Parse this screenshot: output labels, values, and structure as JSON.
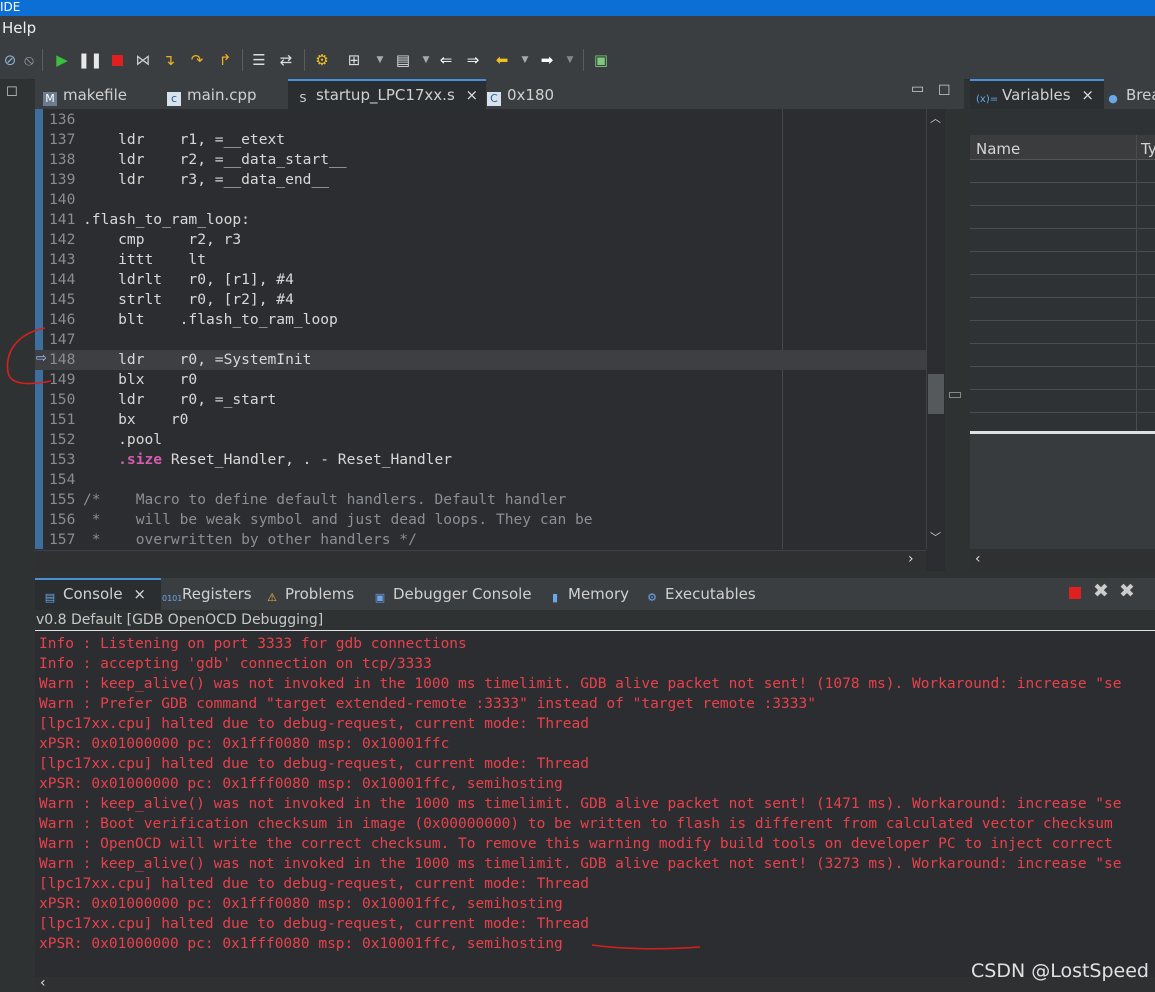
{
  "window": {
    "title_fragment": "IDE"
  },
  "menu": {
    "help": "Help"
  },
  "toolbar": {
    "icons": [
      "skip-breakpoints-icon",
      "resume-icon",
      "suspend-icon",
      "terminate-icon",
      "disconnect-icon",
      "step-into-icon",
      "step-over-icon",
      "step-return-icon",
      "instruction-stepping-icon",
      "restart-icon",
      "build-icon",
      "debug-config-icon",
      "external-tool-icon",
      "back-icon",
      "forward-icon",
      "prev-edit-icon",
      "next-edit-icon",
      "new-window-icon"
    ]
  },
  "editor": {
    "tabs": [
      {
        "label": "makefile",
        "icon": "makefile-icon"
      },
      {
        "label": "main.cpp",
        "icon": "cpp-file-icon"
      },
      {
        "label": "startup_LPC17xx.s",
        "icon": "asm-file-icon",
        "active": true,
        "close": "×"
      },
      {
        "label": "0x180",
        "icon": "disassembly-icon"
      }
    ],
    "lines": [
      {
        "num": "136",
        "text": ""
      },
      {
        "num": "137",
        "text": "    ldr    r1, =__etext"
      },
      {
        "num": "138",
        "text": "    ldr    r2, =__data_start__"
      },
      {
        "num": "139",
        "text": "    ldr    r3, =__data_end__"
      },
      {
        "num": "140",
        "text": ""
      },
      {
        "num": "141",
        "text": ".flash_to_ram_loop:"
      },
      {
        "num": "142",
        "text": "    cmp     r2, r3"
      },
      {
        "num": "143",
        "text": "    ittt    lt"
      },
      {
        "num": "144",
        "text": "    ldrlt   r0, [r1], #4"
      },
      {
        "num": "145",
        "text": "    strlt   r0, [r2], #4"
      },
      {
        "num": "146",
        "text": "    blt    .flash_to_ram_loop"
      },
      {
        "num": "147",
        "text": ""
      },
      {
        "num": "148",
        "text": "    ldr    r0, =SystemInit"
      },
      {
        "num": "149",
        "text": "    blx    r0"
      },
      {
        "num": "150",
        "text": "    ldr    r0, =_start"
      },
      {
        "num": "151",
        "text": "    bx    r0"
      },
      {
        "num": "152",
        "text": "    .pool"
      },
      {
        "num": "153",
        "kw": "    .size",
        "text": " Reset_Handler, . - Reset_Handler"
      },
      {
        "num": "154",
        "text": ""
      },
      {
        "num": "155",
        "text": "/*    Macro to define default handlers. Default handler"
      },
      {
        "num": "156",
        "text": " *    will be weak symbol and just dead loops. They can be"
      },
      {
        "num": "157",
        "text": " *    overwritten by other handlers */"
      }
    ],
    "current_line": "148"
  },
  "variables": {
    "tabs": [
      {
        "label": "Variables",
        "icon": "variables-icon",
        "close": "×"
      },
      {
        "label": "Brea",
        "icon": "breakpoints-icon"
      }
    ],
    "columns": [
      "Name",
      "Ty"
    ]
  },
  "console": {
    "tabs": [
      {
        "label": "Console",
        "icon": "console-icon",
        "close": "×"
      },
      {
        "label": "Registers",
        "icon": "registers-icon"
      },
      {
        "label": "Problems",
        "icon": "problems-icon"
      },
      {
        "label": "Debugger Console",
        "icon": "debugger-console-icon"
      },
      {
        "label": "Memory",
        "icon": "memory-icon"
      },
      {
        "label": "Executables",
        "icon": "executables-icon"
      }
    ],
    "session": "v0.8 Default [GDB OpenOCD Debugging]",
    "lines": [
      "Info : Listening on port 3333 for gdb connections",
      "Info : accepting 'gdb' connection on tcp/3333",
      "Warn : keep_alive() was not invoked in the 1000 ms timelimit. GDB alive packet not sent! (1078 ms). Workaround: increase \"se",
      "Warn : Prefer GDB command \"target extended-remote :3333\" instead of \"target remote :3333\"",
      "[lpc17xx.cpu] halted due to debug-request, current mode: Thread",
      "xPSR: 0x01000000 pc: 0x1fff0080 msp: 0x10001ffc",
      "[lpc17xx.cpu] halted due to debug-request, current mode: Thread",
      "xPSR: 0x01000000 pc: 0x1fff0080 msp: 0x10001ffc, semihosting",
      "Warn : keep_alive() was not invoked in the 1000 ms timelimit. GDB alive packet not sent! (1471 ms). Workaround: increase \"se",
      "Warn : Boot verification checksum in image (0x00000000) to be written to flash is different from calculated vector checksum",
      "Warn : OpenOCD will write the correct checksum. To remove this warning modify build tools on developer PC to inject correct",
      "Warn : keep_alive() was not invoked in the 1000 ms timelimit. GDB alive packet not sent! (3273 ms). Workaround: increase \"se",
      "[lpc17xx.cpu] halted due to debug-request, current mode: Thread",
      "xPSR: 0x01000000 pc: 0x1fff0080 msp: 0x10001ffc, semihosting",
      "[lpc17xx.cpu] halted due to debug-request, current mode: Thread",
      "xPSR: 0x01000000 pc: 0x1fff0080 msp: 0x10001ffc, semihosting"
    ]
  },
  "watermark": "CSDN @LostSpeed",
  "colors": {
    "accent": "#4a90d9",
    "console_text": "#e8414b",
    "annotation": "#d8201b"
  }
}
